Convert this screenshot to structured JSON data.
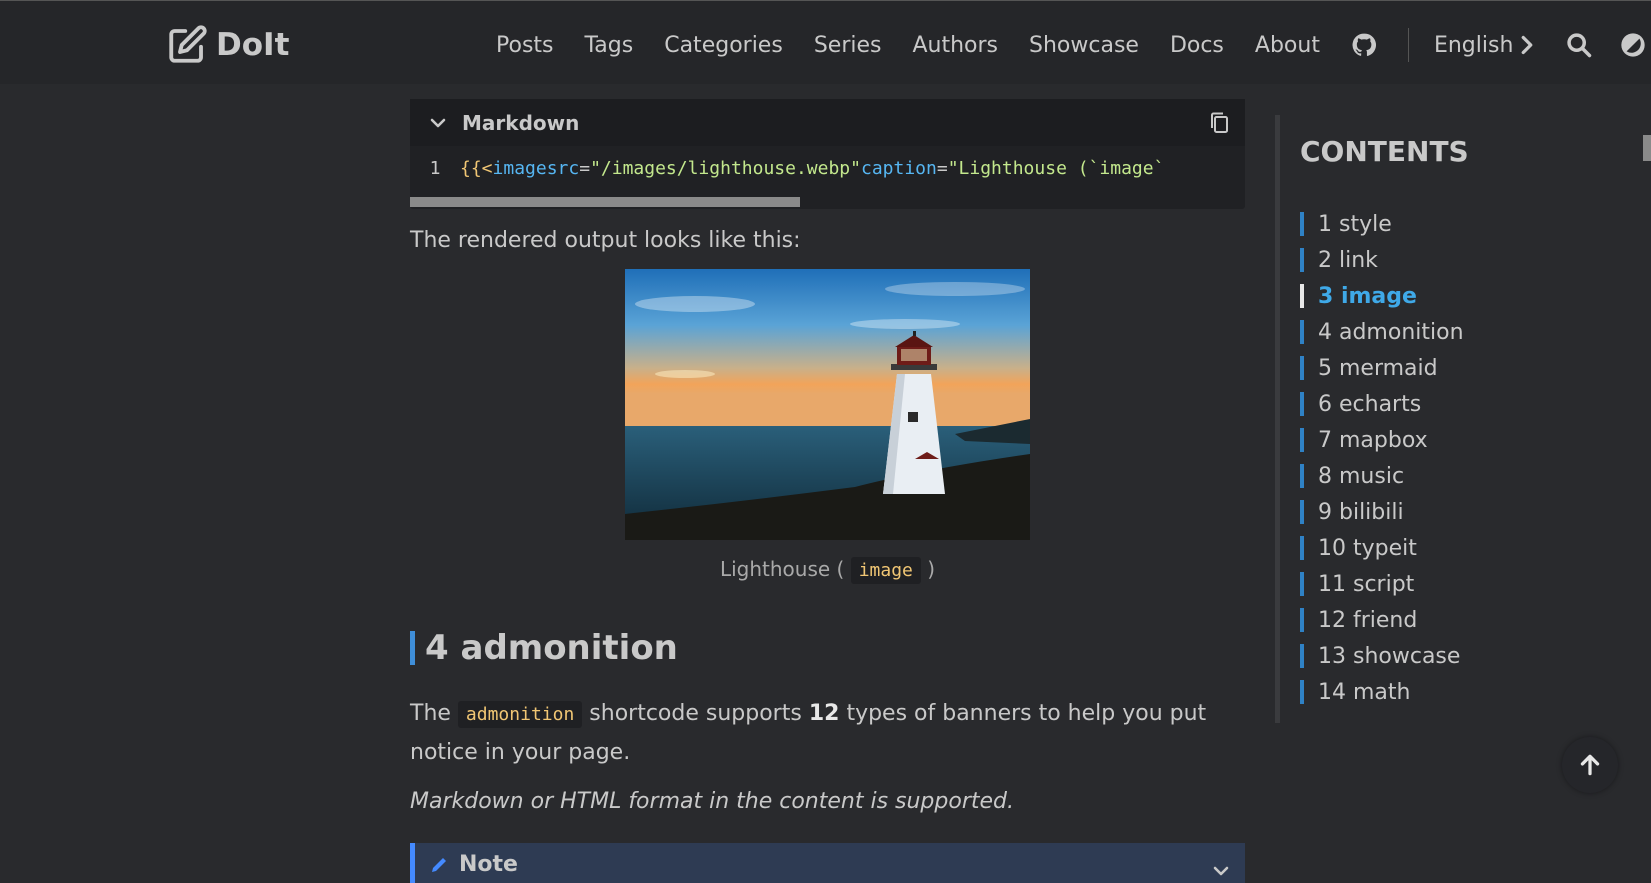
{
  "header": {
    "logo_text": "DoIt",
    "nav": [
      "Posts",
      "Tags",
      "Categories",
      "Series",
      "Authors",
      "Showcase",
      "Docs",
      "About"
    ],
    "language": "English"
  },
  "code_block": {
    "language": "Markdown",
    "line_number": "1",
    "code_tokens": {
      "t1": "{{<",
      "t2": " image",
      "t3": " src",
      "t4": "=",
      "t5": "\"/images/lighthouse.webp\"",
      "t6": " caption",
      "t7": "=",
      "t8": "\"Lighthouse (`image`"
    }
  },
  "rendered_intro": "The rendered output looks like this:",
  "figure": {
    "caption_prefix": "Lighthouse (",
    "caption_code": "image",
    "caption_suffix": ")"
  },
  "section": {
    "heading": "4 admonition",
    "para1_before": "The",
    "para1_code": "admonition",
    "para1_middle": "shortcode supports",
    "para1_bold": "12",
    "para1_after": "types of banners to help you put",
    "para1_line2": "notice in your page.",
    "para2": "Markdown or HTML format in the content is supported."
  },
  "note": {
    "label": "Note"
  },
  "toc": {
    "title": "CONTENTS",
    "items": [
      {
        "label": "1 style"
      },
      {
        "label": "2 link"
      },
      {
        "label": "3 image",
        "active": true
      },
      {
        "label": "4 admonition"
      },
      {
        "label": "5 mermaid"
      },
      {
        "label": "6 echarts"
      },
      {
        "label": "7 mapbox"
      },
      {
        "label": "8 music"
      },
      {
        "label": "9 bilibili"
      },
      {
        "label": "10 typeit"
      },
      {
        "label": "11 script"
      },
      {
        "label": "12 friend"
      },
      {
        "label": "13 showcase"
      },
      {
        "label": "14 math"
      }
    ]
  },
  "colors": {
    "background": "#292a2d",
    "accent": "#3fa9e8",
    "note": "#448aff"
  }
}
